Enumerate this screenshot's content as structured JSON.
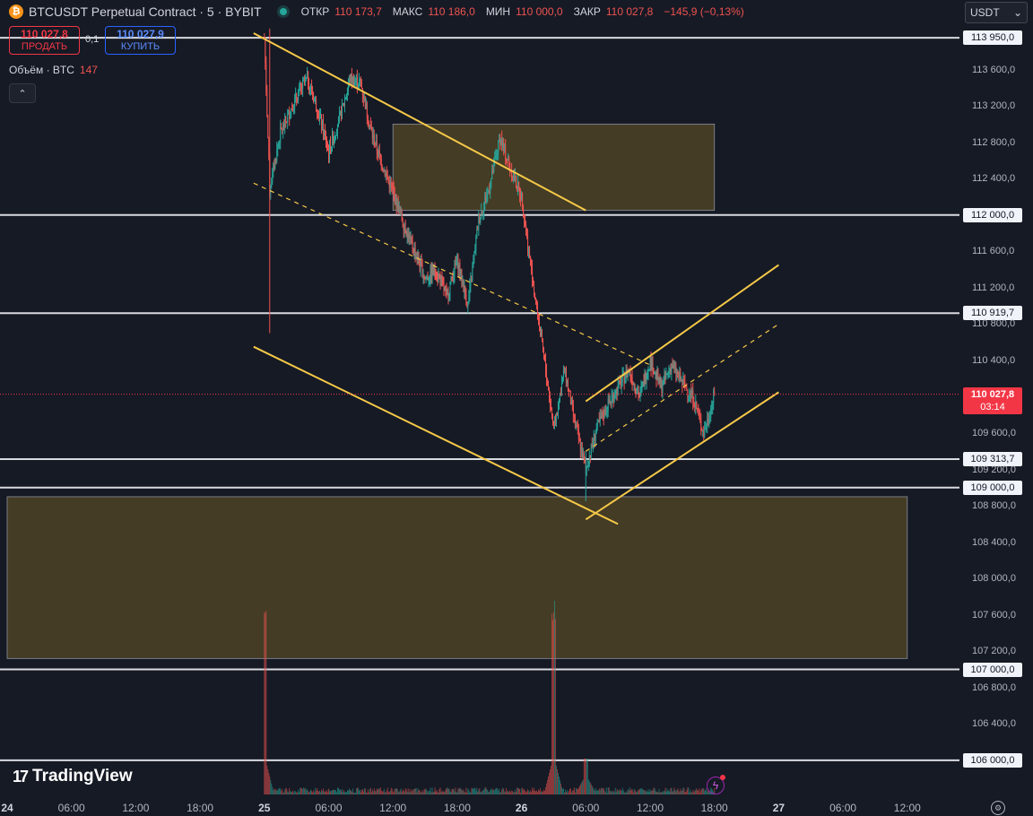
{
  "header": {
    "symbol_icon": "bitcoin-icon",
    "symbol_icon_glyph": "₿",
    "title": "BTCUSDT Perpetual Contract · 5 · BYBIT",
    "ohlc": [
      {
        "label": "ОТКР",
        "value": "110 173,7"
      },
      {
        "label": "МАКС",
        "value": "110 186,0"
      },
      {
        "label": "МИН",
        "value": "110 000,0"
      },
      {
        "label": "ЗАКР",
        "value": "110 027,8"
      }
    ],
    "change": "−145,9 (−0,13%)"
  },
  "trade": {
    "sell_price": "110 027,8",
    "sell_label": "ПРОДАТЬ",
    "spread": "0,1",
    "buy_price": "110 027,9",
    "buy_label": "КУПИТЬ"
  },
  "volume_legend": {
    "label": "Объём · BTC",
    "value": "147"
  },
  "collapse_glyph": "⌃",
  "currency": {
    "value": "USDT",
    "chevron": "⌄"
  },
  "price_axis": {
    "min": 105800,
    "max": 114100,
    "ticks": [
      "113 600,0",
      "113 200,0",
      "112 800,0",
      "112 400,0",
      "111 600,0",
      "111 200,0",
      "110 800,0",
      "110 400,0",
      "109 600,0",
      "109 200,0",
      "108 800,0",
      "108 400,0",
      "108 000,0",
      "107 600,0",
      "107 200,0",
      "106 800,0",
      "106 400,0"
    ],
    "tick_values": [
      113600,
      113200,
      112800,
      112400,
      111600,
      111200,
      110800,
      110400,
      109600,
      109200,
      108800,
      108400,
      108000,
      107600,
      107200,
      106800,
      106400
    ]
  },
  "horizontal_levels": [
    {
      "price": 113950,
      "label": "113 950,0"
    },
    {
      "price": 112000,
      "label": "112 000,0"
    },
    {
      "price": 110919.7,
      "label": "110 919,7"
    },
    {
      "price": 109313.7,
      "label": "109 313,7"
    },
    {
      "price": 109000,
      "label": "109 000,0"
    },
    {
      "price": 107000,
      "label": "107 000,0"
    },
    {
      "price": 106000,
      "label": "106 000,0"
    }
  ],
  "current_price": {
    "price": 110027.8,
    "label": "110 027,8",
    "countdown": "03:14",
    "color": "#f23645"
  },
  "time_axis": [
    {
      "label": "24",
      "major": true
    },
    {
      "label": "06:00",
      "major": false
    },
    {
      "label": "12:00",
      "major": false
    },
    {
      "label": "18:00",
      "major": false
    },
    {
      "label": "25",
      "major": true
    },
    {
      "label": "06:00",
      "major": false
    },
    {
      "label": "12:00",
      "major": false
    },
    {
      "label": "18:00",
      "major": false
    },
    {
      "label": "26",
      "major": true
    },
    {
      "label": "06:00",
      "major": false
    },
    {
      "label": "12:00",
      "major": false
    },
    {
      "label": "18:00",
      "major": false
    },
    {
      "label": "27",
      "major": true
    },
    {
      "label": "06:00",
      "major": false
    },
    {
      "label": "12:00",
      "major": false
    }
  ],
  "zones": [
    {
      "name": "supply-zone",
      "from_time": "25 12:00",
      "to_time": "26 18:00",
      "price_top": 113000,
      "price_bottom": 112050
    },
    {
      "name": "demand-zone",
      "from_time": "24 00:00",
      "to_time": "27 12:00",
      "price_top": 108900,
      "price_bottom": 107120
    }
  ],
  "colors": {
    "background": "#161a25",
    "trendline": "#f7c948",
    "zone": "#6b5a26",
    "candle_up": "#26a69a",
    "candle_down": "#ef5350"
  },
  "logo": {
    "text": "TradingView",
    "icon": "tradingview-logo-icon",
    "glyph": "17"
  },
  "icons": {
    "flash": "flash-icon",
    "settings": "settings-icon",
    "flash_glyph": "ϟ",
    "settings_glyph": "⚙"
  },
  "chart_data": {
    "type": "candlestick",
    "x_unit": "time",
    "y_unit": "USDT",
    "price_path": [
      {
        "t": "25 00:00",
        "p": 113950
      },
      {
        "t": "25 00:30",
        "p": 112300
      },
      {
        "t": "25 01:30",
        "p": 112900
      },
      {
        "t": "25 03:00",
        "p": 113300
      },
      {
        "t": "25 04:00",
        "p": 113500
      },
      {
        "t": "25 05:00",
        "p": 113150
      },
      {
        "t": "25 06:00",
        "p": 112700
      },
      {
        "t": "25 07:00",
        "p": 113050
      },
      {
        "t": "25 08:00",
        "p": 113500
      },
      {
        "t": "25 09:00",
        "p": 113450
      },
      {
        "t": "25 10:00",
        "p": 112900
      },
      {
        "t": "25 11:00",
        "p": 112550
      },
      {
        "t": "25 12:00",
        "p": 112250
      },
      {
        "t": "25 13:00",
        "p": 111900
      },
      {
        "t": "25 14:00",
        "p": 111600
      },
      {
        "t": "25 15:00",
        "p": 111300
      },
      {
        "t": "25 16:00",
        "p": 111400
      },
      {
        "t": "25 17:00",
        "p": 111100
      },
      {
        "t": "25 18:00",
        "p": 111500
      },
      {
        "t": "25 19:00",
        "p": 111000
      },
      {
        "t": "25 20:00",
        "p": 111950
      },
      {
        "t": "25 21:00",
        "p": 112300
      },
      {
        "t": "25 22:00",
        "p": 112850
      },
      {
        "t": "25 23:00",
        "p": 112500
      },
      {
        "t": "26 00:00",
        "p": 112200
      },
      {
        "t": "26 01:00",
        "p": 111300
      },
      {
        "t": "26 02:00",
        "p": 110500
      },
      {
        "t": "26 03:00",
        "p": 109650
      },
      {
        "t": "26 04:00",
        "p": 110300
      },
      {
        "t": "26 05:00",
        "p": 109700
      },
      {
        "t": "26 06:00",
        "p": 109200
      },
      {
        "t": "26 07:00",
        "p": 109650
      },
      {
        "t": "26 08:00",
        "p": 109900
      },
      {
        "t": "26 09:00",
        "p": 110100
      },
      {
        "t": "26 10:00",
        "p": 110300
      },
      {
        "t": "26 11:00",
        "p": 110000
      },
      {
        "t": "26 12:00",
        "p": 110400
      },
      {
        "t": "26 13:00",
        "p": 110100
      },
      {
        "t": "26 14:00",
        "p": 110350
      },
      {
        "t": "26 15:00",
        "p": 110150
      },
      {
        "t": "26 16:00",
        "p": 110000
      },
      {
        "t": "26 17:00",
        "p": 109600
      },
      {
        "t": "26 17:30",
        "p": 109800
      },
      {
        "t": "26 18:00",
        "p": 110027.8
      }
    ],
    "volume_spikes": [
      {
        "t": "25 00:00",
        "v": "high"
      },
      {
        "t": "26 03:00",
        "v": "high"
      },
      {
        "t": "26 06:00",
        "v": "medium"
      }
    ],
    "trendlines": [
      {
        "name": "channel-upper",
        "from": {
          "t": "24 23:00",
          "p": 114000
        },
        "to": {
          "t": "26 06:00",
          "p": 112050
        }
      },
      {
        "name": "channel-lower",
        "from": {
          "t": "24 23:00",
          "p": 110550
        },
        "to": {
          "t": "26 09:00",
          "p": 108600
        }
      },
      {
        "name": "channel-mid",
        "from": {
          "t": "24 23:00",
          "p": 112350
        },
        "to": {
          "t": "26 12:00",
          "p": 110350
        },
        "dashed": true
      },
      {
        "name": "rising-upper",
        "from": {
          "t": "26 06:00",
          "p": 109950
        },
        "to": {
          "t": "27 00:00",
          "p": 111450
        }
      },
      {
        "name": "rising-lower",
        "from": {
          "t": "26 06:00",
          "p": 108650
        },
        "to": {
          "t": "27 00:00",
          "p": 110050
        }
      },
      {
        "name": "rising-mid",
        "from": {
          "t": "26 06:00",
          "p": 109400
        },
        "to": {
          "t": "27 00:00",
          "p": 110800
        },
        "dashed": true
      }
    ]
  }
}
